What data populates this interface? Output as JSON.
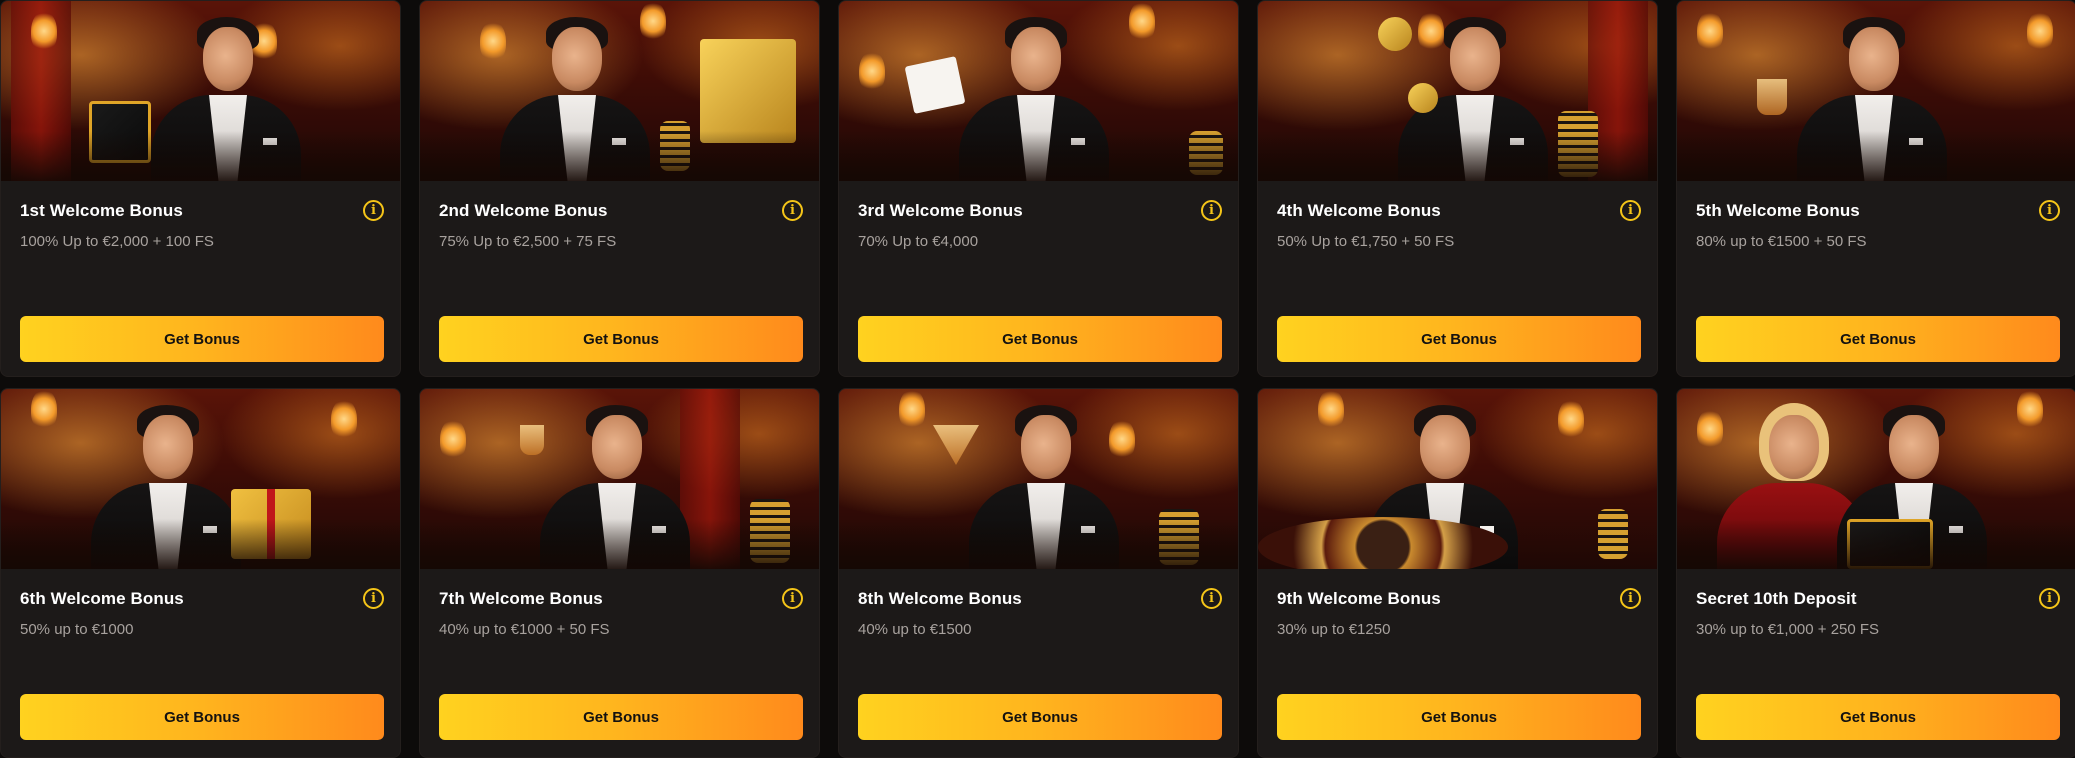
{
  "cards": [
    {
      "title": "1st Welcome Bonus",
      "offer": "100% Up to €2,000 + 100 FS",
      "button": "Get Bonus",
      "info_icon": "info-icon",
      "prop": "gift"
    },
    {
      "title": "2nd Welcome Bonus",
      "offer": "75% Up to €2,500 + 75 FS",
      "button": "Get Bonus",
      "info_icon": "info-icon",
      "prop": "safe"
    },
    {
      "title": "3rd Welcome Bonus",
      "offer": "70% Up to €4,000",
      "button": "Get Bonus",
      "info_icon": "info-icon",
      "prop": "cards"
    },
    {
      "title": "4th Welcome Bonus",
      "offer": "50% Up to €1,750 + 50 FS",
      "button": "Get Bonus",
      "info_icon": "info-icon",
      "prop": "chip"
    },
    {
      "title": "5th Welcome Bonus",
      "offer": "80% up to €1500 + 50 FS",
      "button": "Get Bonus",
      "info_icon": "info-icon",
      "prop": "glass"
    },
    {
      "title": "6th Welcome Bonus",
      "offer": "50% up to €1000",
      "button": "Get Bonus",
      "info_icon": "info-icon",
      "prop": "gift"
    },
    {
      "title": "7th Welcome Bonus",
      "offer": "40% up to €1000 + 50 FS",
      "button": "Get Bonus",
      "info_icon": "info-icon",
      "prop": "chips"
    },
    {
      "title": "8th Welcome Bonus",
      "offer": "40% up to €1500",
      "button": "Get Bonus",
      "info_icon": "info-icon",
      "prop": "martini"
    },
    {
      "title": "9th Welcome Bonus",
      "offer": "30% up to €1250",
      "button": "Get Bonus",
      "info_icon": "info-icon",
      "prop": "roulette"
    },
    {
      "title": "Secret 10th Deposit",
      "offer": "30% up to €1,000 + 250 FS",
      "button": "Get Bonus",
      "info_icon": "info-icon",
      "prop": "couple"
    }
  ],
  "colors": {
    "background": "#0d0b0a",
    "card": "#1c1918",
    "accent": "#f5c518",
    "button_start": "#ffd21f",
    "button_end": "#ff8a1c",
    "subtitle": "#a8a29e"
  }
}
